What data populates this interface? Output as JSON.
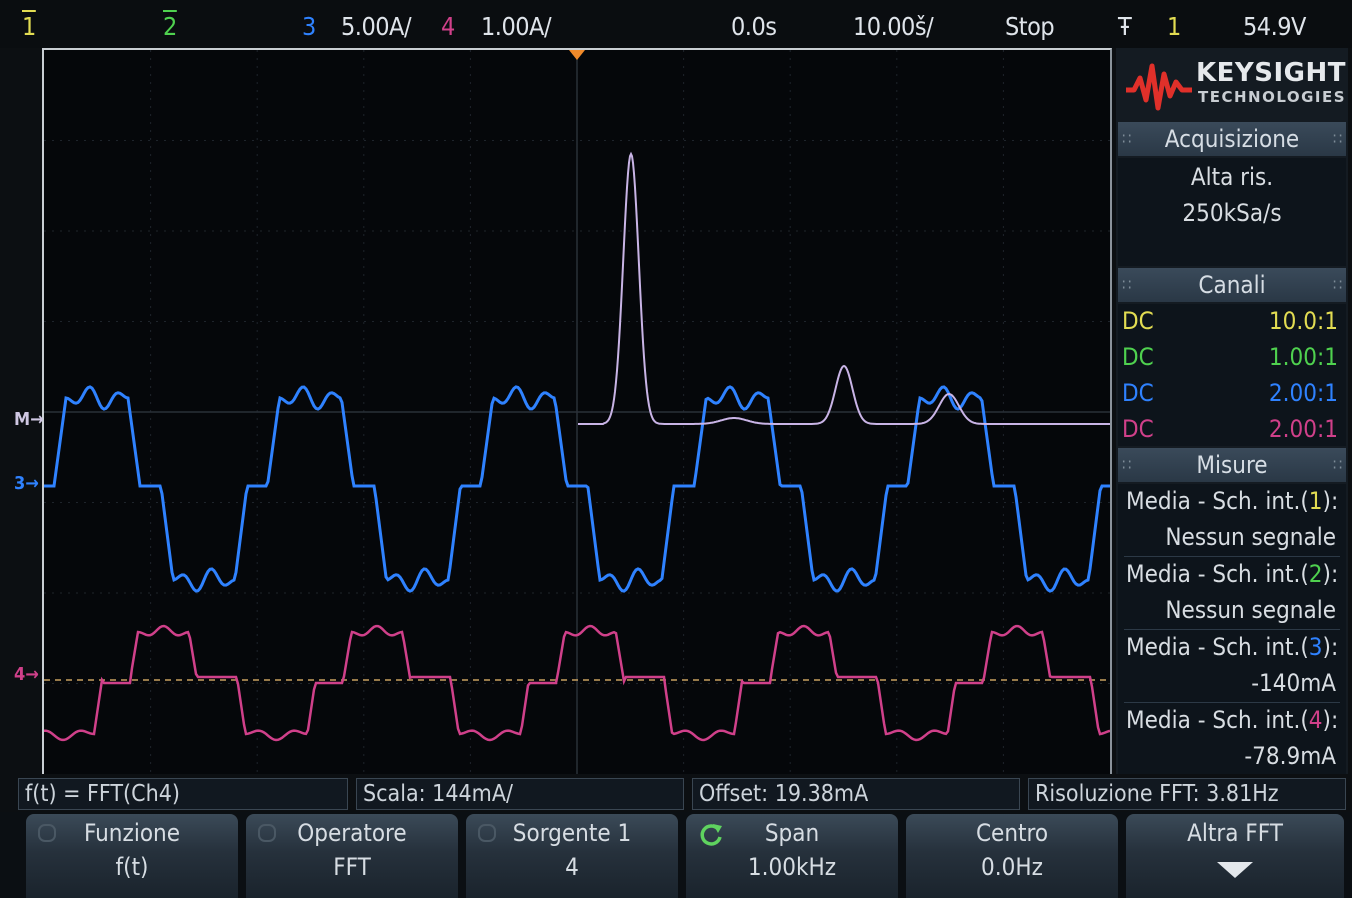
{
  "topbar": {
    "ch1": "1",
    "ch2": "2",
    "ch3": "3",
    "ch3_scale": "5.00A/",
    "ch4": "4",
    "ch4_scale": "1.00A/",
    "delay": "0.0s",
    "timebase": "10.00š/",
    "run_state": "Stop",
    "trig_slope": "Ŧ",
    "trig_source": "1",
    "trig_level": "54.9V"
  },
  "markers": {
    "math": "M",
    "ch3": "3",
    "ch4": "4"
  },
  "logo": {
    "name": "KEYSIGHT",
    "sub": "TECHNOLOGIES"
  },
  "acquisition": {
    "header": "Acquisizione",
    "mode": "Alta ris.",
    "rate": "250kSa/s"
  },
  "channels": {
    "header": "Canali",
    "rows": [
      {
        "coupling": "DC",
        "probe": "10.0:1"
      },
      {
        "coupling": "DC",
        "probe": "1.00:1"
      },
      {
        "coupling": "DC",
        "probe": "2.00:1"
      },
      {
        "coupling": "DC",
        "probe": "2.00:1"
      }
    ]
  },
  "measurements": {
    "header": "Misure",
    "items": [
      {
        "label_pre": "Media - Sch. int.(",
        "ch": "1",
        "label_post": "):",
        "value": "Nessun segnale"
      },
      {
        "label_pre": "Media - Sch. int.(",
        "ch": "2",
        "label_post": "):",
        "value": "Nessun segnale"
      },
      {
        "label_pre": "Media - Sch. int.(",
        "ch": "3",
        "label_post": "):",
        "value": "-140mA"
      },
      {
        "label_pre": "Media - Sch. int.(",
        "ch": "4",
        "label_post": "):",
        "value": "-78.9mA"
      }
    ]
  },
  "fft_info": {
    "function": "f(t) = FFT(Ch4)",
    "scale": "Scala: 144mA/",
    "offset": "Offset: 19.38mA",
    "resolution": "Risoluzione FFT: 3.81Hz"
  },
  "softkeys": [
    {
      "label": "Funzione",
      "value": "f(t)"
    },
    {
      "label": "Operatore",
      "value": "FFT"
    },
    {
      "label": "Sorgente 1",
      "value": "4"
    },
    {
      "label": "Span",
      "value": "1.00kHz"
    },
    {
      "label": "Centro",
      "value": "0.0Hz"
    },
    {
      "label": "Altra FFT",
      "value": ""
    }
  ],
  "colors": {
    "ch1": "#e2dc52",
    "ch2": "#4fd14f",
    "ch3": "#2f82ff",
    "ch4": "#d0408a",
    "math": "#c9b4e6"
  }
}
